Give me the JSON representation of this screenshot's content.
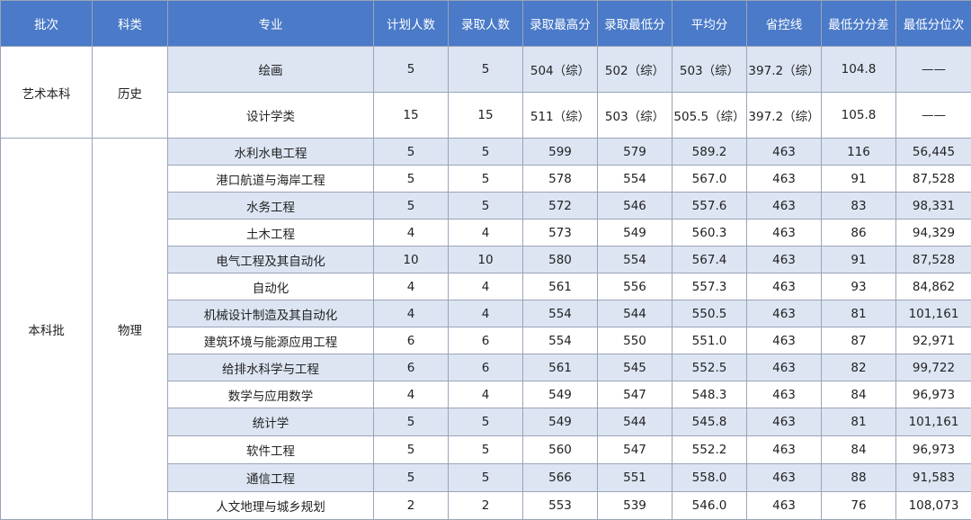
{
  "headers": [
    "批次",
    "科类",
    "专业",
    "计划人数",
    "录取人数",
    "录取最高分",
    "录取最低分",
    "平均分",
    "省控线",
    "最低分分差",
    "最低分位次"
  ],
  "groups": [
    {
      "batch": "艺术本科",
      "category": "历史",
      "rows": [
        [
          "绘画",
          "5",
          "5",
          "504（综）",
          "502（综）",
          "503（综）",
          "397.2（综）",
          "104.8",
          "——"
        ],
        [
          "设计学类",
          "15",
          "15",
          "511（综）",
          "503（综）",
          "505.5（综）",
          "397.2（综）",
          "105.8",
          "——"
        ]
      ]
    },
    {
      "batch": "本科批",
      "category": "物理",
      "rows": [
        [
          "水利水电工程",
          "5",
          "5",
          "599",
          "579",
          "589.2",
          "463",
          "116",
          "56,445"
        ],
        [
          "港口航道与海岸工程",
          "5",
          "5",
          "578",
          "554",
          "567.0",
          "463",
          "91",
          "87,528"
        ],
        [
          "水务工程",
          "5",
          "5",
          "572",
          "546",
          "557.6",
          "463",
          "83",
          "98,331"
        ],
        [
          "土木工程",
          "4",
          "4",
          "573",
          "549",
          "560.3",
          "463",
          "86",
          "94,329"
        ],
        [
          "电气工程及其自动化",
          "10",
          "10",
          "580",
          "554",
          "567.4",
          "463",
          "91",
          "87,528"
        ],
        [
          "自动化",
          "4",
          "4",
          "561",
          "556",
          "557.3",
          "463",
          "93",
          "84,862"
        ],
        [
          "机械设计制造及其自动化",
          "4",
          "4",
          "554",
          "544",
          "550.5",
          "463",
          "81",
          "101,161"
        ],
        [
          "建筑环境与能源应用工程",
          "6",
          "6",
          "554",
          "550",
          "551.0",
          "463",
          "87",
          "92,971"
        ],
        [
          "给排水科学与工程",
          "6",
          "6",
          "561",
          "545",
          "552.5",
          "463",
          "82",
          "99,722"
        ],
        [
          "数学与应用数学",
          "4",
          "4",
          "549",
          "547",
          "548.3",
          "463",
          "84",
          "96,973"
        ],
        [
          "统计学",
          "5",
          "5",
          "549",
          "544",
          "545.8",
          "463",
          "81",
          "101,161"
        ],
        [
          "软件工程",
          "5",
          "5",
          "560",
          "547",
          "552.2",
          "463",
          "84",
          "96,973"
        ],
        [
          "通信工程",
          "5",
          "5",
          "566",
          "551",
          "558.0",
          "463",
          "88",
          "91,583"
        ],
        [
          "人文地理与城乡规划",
          "2",
          "2",
          "553",
          "539",
          "546.0",
          "463",
          "76",
          "108,073"
        ]
      ]
    }
  ]
}
